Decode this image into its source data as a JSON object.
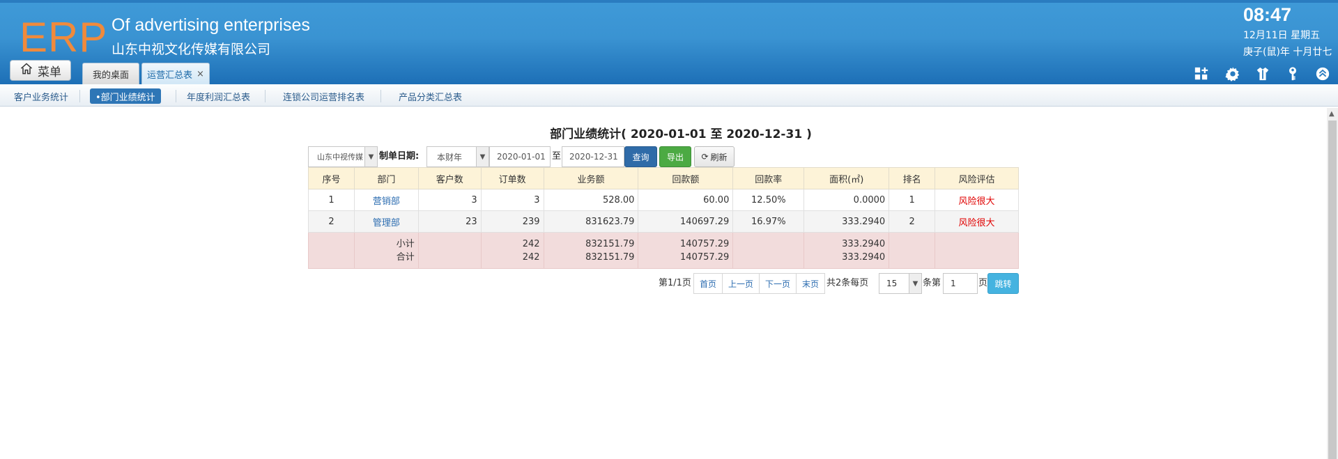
{
  "header": {
    "logo": "ERP",
    "company_en": "Of advertising enterprises",
    "company_cn": "山东中视文化传媒有限公司",
    "time": "08:47",
    "date": "12月11日 星期五",
    "lunar": "庚子(鼠)年 十月廿七",
    "menu_label": "菜单",
    "tabs": [
      {
        "label": "我的桌面"
      },
      {
        "label": "运营汇总表",
        "close": "×"
      }
    ],
    "tools": [
      "grid-add-icon",
      "gear-icon",
      "shirt-icon",
      "key-icon",
      "collapse-up-icon"
    ]
  },
  "subnav": [
    {
      "label": "客户业务统计"
    },
    {
      "label": "•部门业绩统计",
      "active": true
    },
    {
      "label": "年度利润汇总表"
    },
    {
      "label": "连锁公司运营排名表"
    },
    {
      "label": "产品分类汇总表"
    }
  ],
  "report": {
    "title": "部门业绩统计( 2020-01-01 至 2020-12-31 )",
    "company_select": "山东中视传媒",
    "date_label": "制单日期:",
    "period_select": "本财年",
    "start_date": "2020-01-01",
    "to_label": "至",
    "end_date": "2020-12-31",
    "query_btn": "查询",
    "export_btn": "导出",
    "refresh_btn": "刷新"
  },
  "table": {
    "headers": [
      "序号",
      "部门",
      "客户数",
      "订单数",
      "业务额",
      "回款额",
      "回款率",
      "面积(㎡)",
      "排名",
      "风险评估"
    ],
    "rows": [
      {
        "no": "1",
        "dept": "营销部",
        "customers": "3",
        "orders": "3",
        "revenue": "528.00",
        "received": "60.00",
        "rate": "12.50%",
        "area": "0.0000",
        "rank": "1",
        "risk": "风险很大"
      },
      {
        "no": "2",
        "dept": "管理部",
        "customers": "23",
        "orders": "239",
        "revenue": "831623.79",
        "received": "140697.29",
        "rate": "16.97%",
        "area": "333.2940",
        "rank": "2",
        "risk": "风险很大"
      }
    ],
    "subtotal": {
      "label": "小计",
      "orders": "242",
      "revenue": "832151.79",
      "received": "140757.29",
      "area": "333.2940"
    },
    "total": {
      "label": "合计",
      "orders": "242",
      "revenue": "832151.79",
      "received": "140757.29",
      "area": "333.2940"
    }
  },
  "pager": {
    "page_info": "第1/1页",
    "first": "首页",
    "prev": "上一页",
    "next": "下一页",
    "last": "末页",
    "total_text": "共2条每页",
    "page_size": "15",
    "per_text": "条第",
    "page_input": "1",
    "page_text": "页",
    "go": "跳转"
  }
}
